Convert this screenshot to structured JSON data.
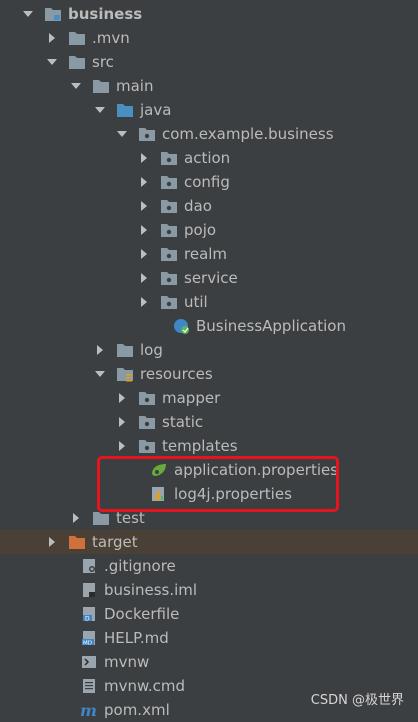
{
  "project_tree": {
    "root": "business",
    "mvn": ".mvn",
    "src": "src",
    "main": "main",
    "java": "java",
    "package": "com.example.business",
    "packages": [
      "action",
      "config",
      "dao",
      "pojo",
      "realm",
      "service",
      "util"
    ],
    "app_class": "BusinessApplication",
    "log": "log",
    "resources": "resources",
    "resource_dirs": [
      "mapper",
      "static",
      "templates"
    ],
    "app_props": "application.properties",
    "log4j_props": "log4j.properties",
    "test": "test",
    "target": "target",
    "files": [
      ".gitignore",
      "business.iml",
      "Dockerfile",
      "HELP.md",
      "mvnw",
      "mvnw.cmd",
      "pom.xml"
    ]
  },
  "watermark": "CSDN @极世界",
  "colors": {
    "background": "#3c3f41",
    "folder": "#8a9aa4",
    "source_folder": "#4a8fc2",
    "excluded_folder": "#d0703a",
    "highlight": "#e5141f"
  }
}
